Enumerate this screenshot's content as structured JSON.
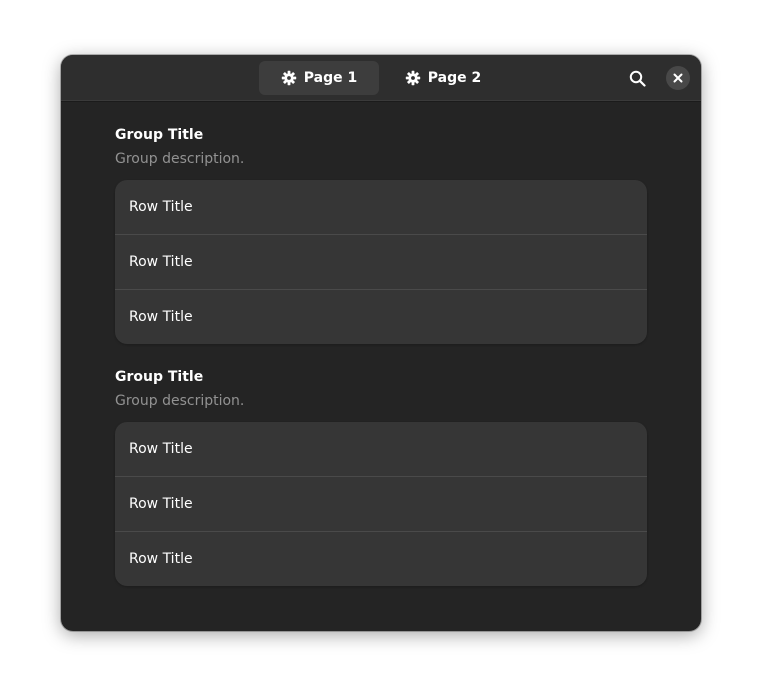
{
  "tabs": [
    {
      "label": "Page 1",
      "icon": "gear-icon",
      "active": true
    },
    {
      "label": "Page 2",
      "icon": "gear-icon",
      "active": false
    }
  ],
  "header": {
    "search_icon": "search-icon",
    "close_icon": "close-icon"
  },
  "groups": [
    {
      "title": "Group Title",
      "description": "Group description.",
      "rows": [
        "Row Title",
        "Row Title",
        "Row Title"
      ]
    },
    {
      "title": "Group Title",
      "description": "Group description.",
      "rows": [
        "Row Title",
        "Row Title",
        "Row Title"
      ]
    }
  ],
  "colors": {
    "window_bg": "#242424",
    "headerbar_bg": "#2e2e2e",
    "active_tab_bg": "#3d3d3d",
    "list_bg": "#363636",
    "text": "#ffffff",
    "dim_text": "#929292"
  }
}
